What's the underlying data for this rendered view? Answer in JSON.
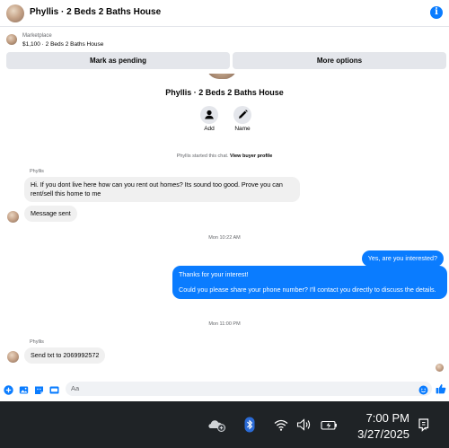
{
  "header": {
    "title": "Phyllis · 2 Beds 2 Baths House",
    "info_glyph": "i"
  },
  "listing": {
    "source": "Marketplace",
    "price_title": "$1,100 · 2 Beds 2 Baths House",
    "mark_pending_label": "Mark as pending",
    "more_options_label": "More options"
  },
  "profile": {
    "name": "Phyllis · 2 Beds 2 Baths House",
    "add_label": "Add",
    "name_label": "Name",
    "started_text": "Phyllis started this chat.",
    "view_buyer_profile": "View buyer profile"
  },
  "messages": {
    "sender1": "Phyllis",
    "in1": "Hi. If you dont live here how can you rent out homes? Its sound too good. Prove you can rent/sell this home to me",
    "in2": "Message sent",
    "ts1": "Mon 10:22 AM",
    "out1": "Yes, are you interested?",
    "out2_line1": "Thanks for your interest!",
    "out2_line2": "Could you please share your phone number? I'll contact you directly to discuss the details.",
    "ts2": "Mon 11:00 PM",
    "sender2": "Phyllis",
    "in3": "Send txt to 2069992572"
  },
  "composer": {
    "placeholder": "Aa"
  },
  "taskbar": {
    "time": "7:00 PM",
    "date": "3/27/2025"
  },
  "colors": {
    "accent_blue": "#0a7cff",
    "bubble_gray": "#f0f0f0",
    "taskbar_bg": "#1f2326"
  }
}
